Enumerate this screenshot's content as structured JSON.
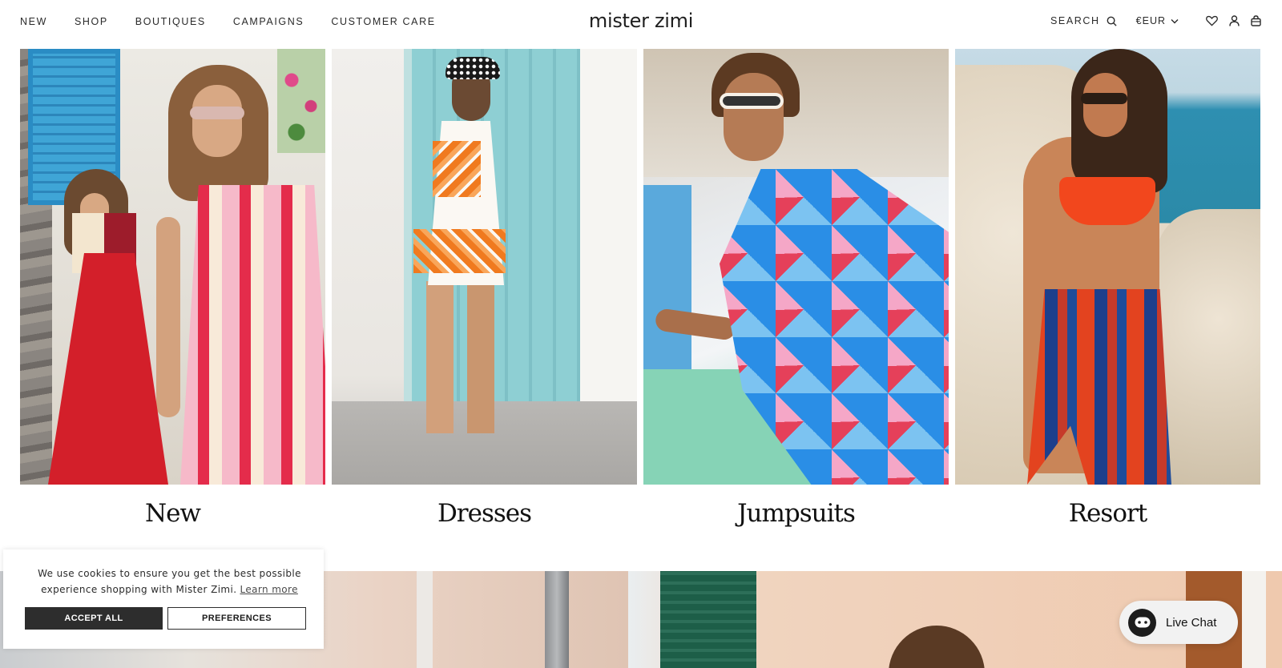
{
  "nav": {
    "items": [
      "NEW",
      "SHOP",
      "BOUTIQUES",
      "CAMPAIGNS",
      "CUSTOMER CARE"
    ],
    "logo": "mister zimi",
    "search_label": "SEARCH",
    "currency": "€EUR",
    "icons": [
      "search-icon",
      "chevron-down-icon",
      "heart-icon",
      "account-icon",
      "bag-icon"
    ]
  },
  "categories": [
    {
      "label": "New"
    },
    {
      "label": "Dresses"
    },
    {
      "label": "Jumpsuits"
    },
    {
      "label": "Resort"
    }
  ],
  "cookie": {
    "text": "We use cookies to ensure you get the best possible experience shopping with Mister Zimi.",
    "link": "Learn more",
    "accept": "ACCEPT ALL",
    "preferences": "PREFERENCES"
  },
  "chat": {
    "label": "Live Chat"
  },
  "colors": {
    "button_dark": "#2d2d2d",
    "text": "#1a1a1a",
    "chat_bg": "#f2f2f2"
  }
}
